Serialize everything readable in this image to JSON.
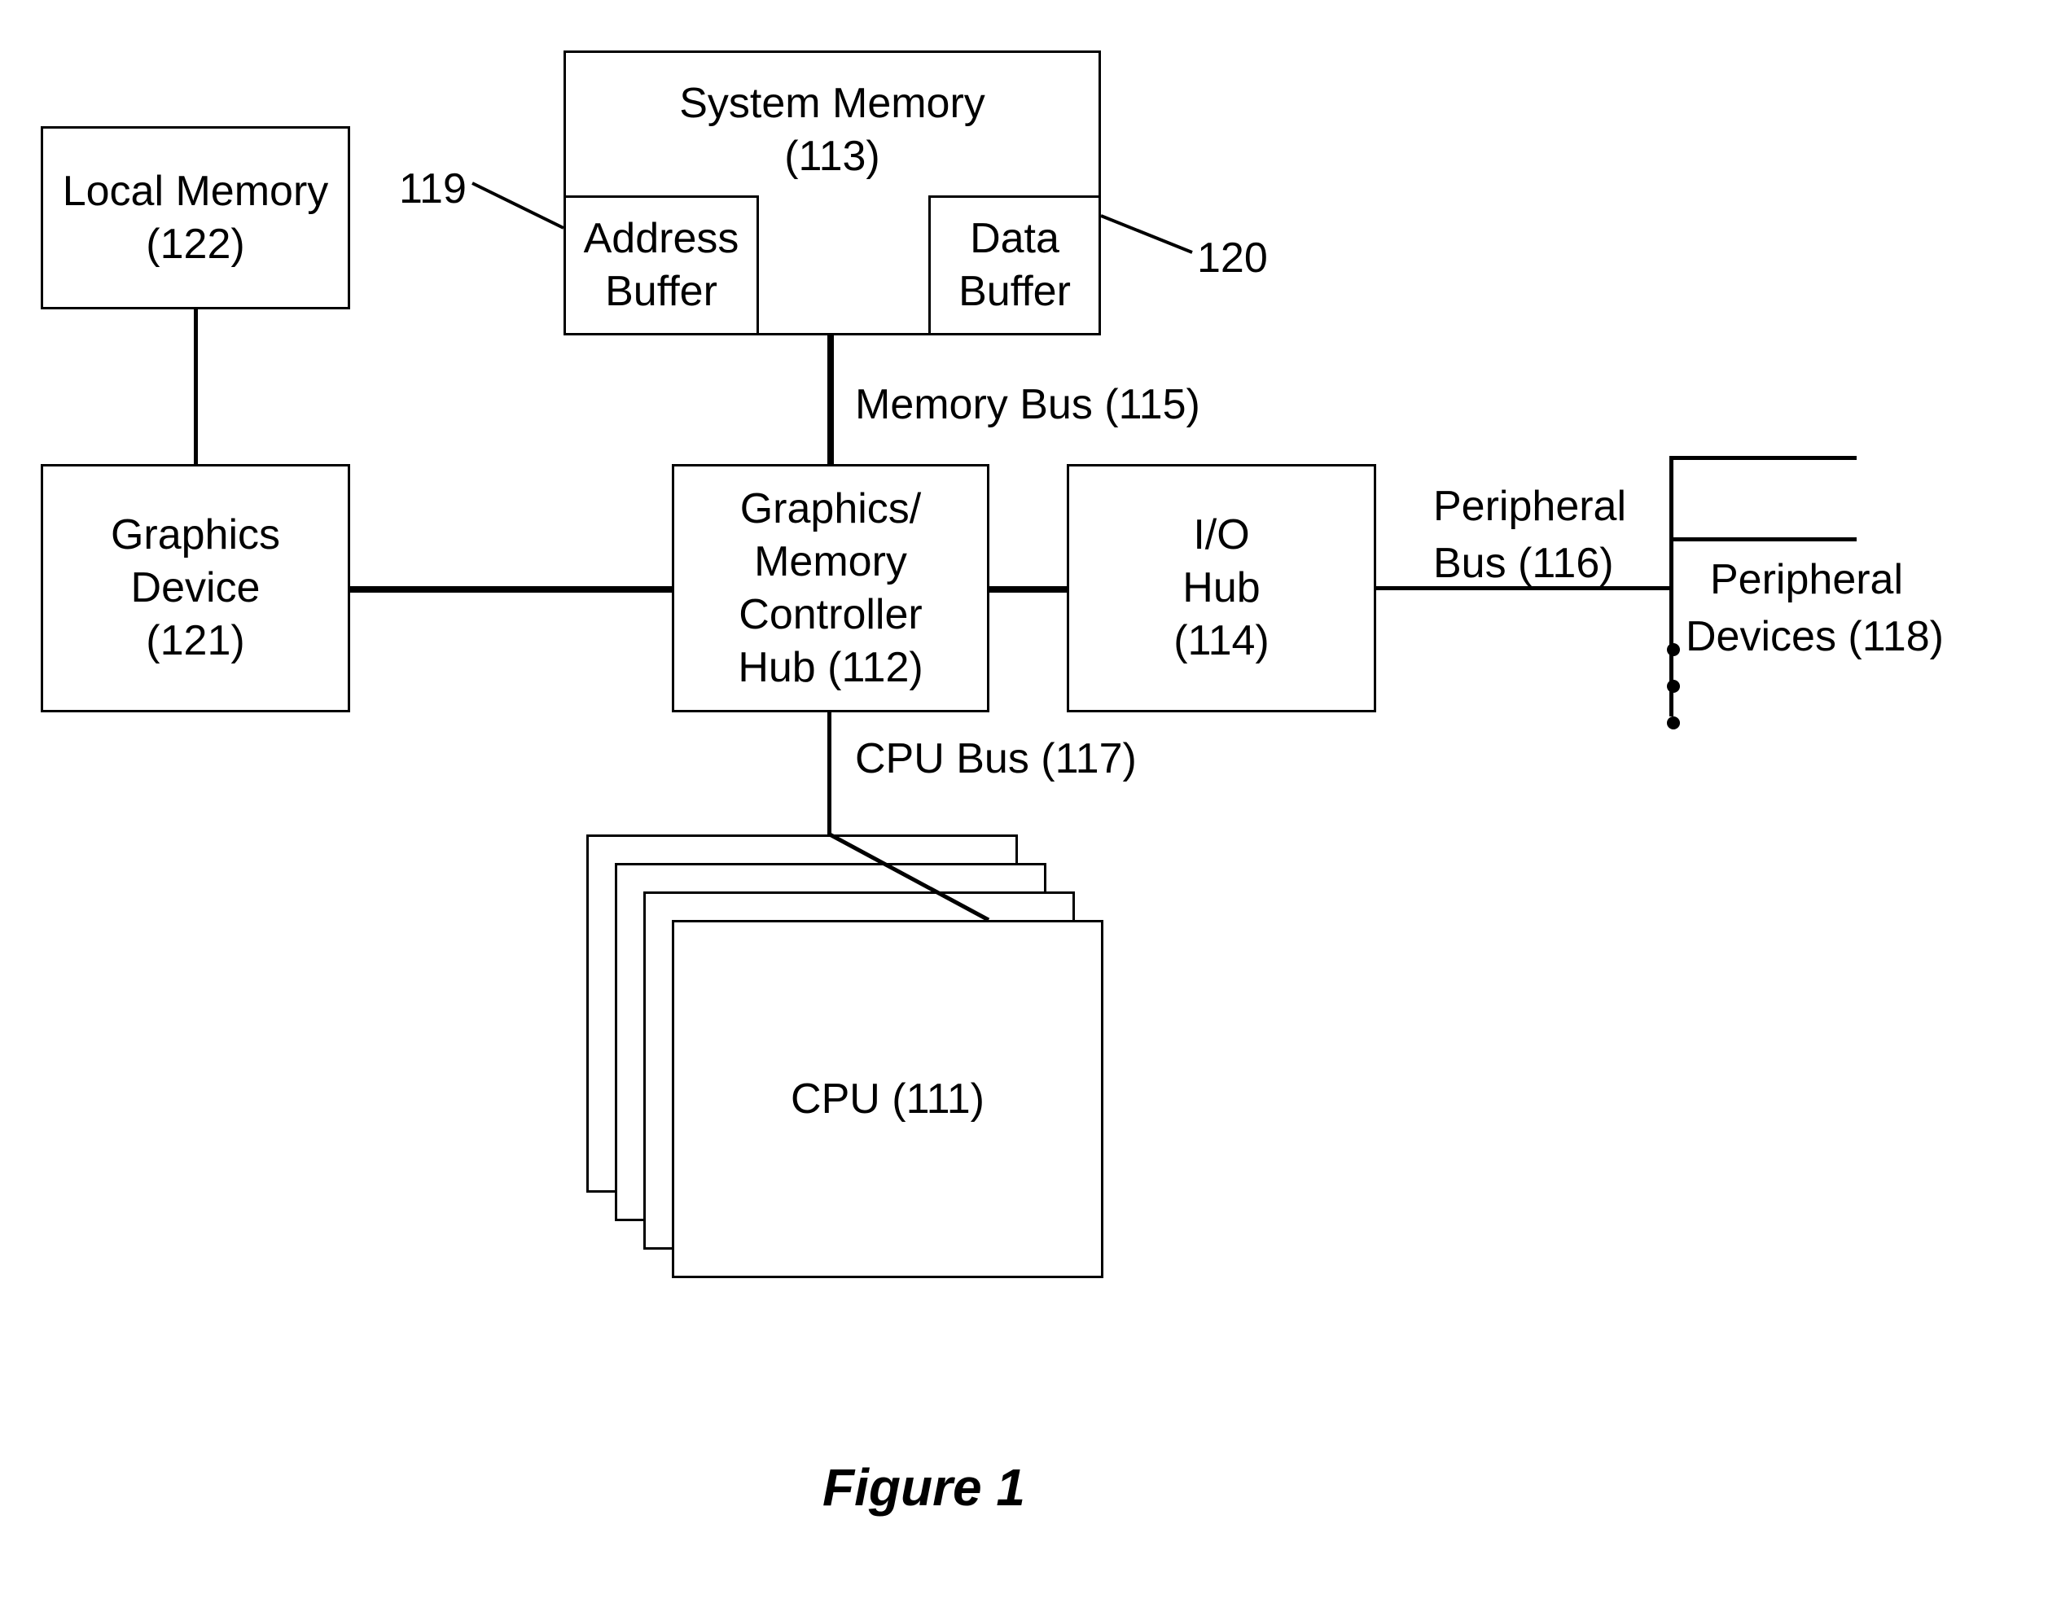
{
  "figure_caption": "Figure 1",
  "blocks": {
    "local_memory": {
      "line1": "Local Memory",
      "line2": "(122)"
    },
    "system_memory": {
      "line1": "System Memory",
      "line2": "(113)"
    },
    "address_buffer": {
      "line1": "Address",
      "line2": "Buffer"
    },
    "data_buffer": {
      "line1": "Data",
      "line2": "Buffer"
    },
    "graphics_device": {
      "line1": "Graphics",
      "line2": "Device",
      "line3": "(121)"
    },
    "gmch": {
      "line1": "Graphics/",
      "line2": "Memory",
      "line3": "Controller",
      "line4": "Hub (112)"
    },
    "io_hub": {
      "line1": "I/O",
      "line2": "Hub",
      "line3": "(114)"
    },
    "cpu": {
      "line1": "CPU (111)"
    }
  },
  "labels": {
    "ref_119": "119",
    "ref_120": "120",
    "memory_bus": "Memory Bus (115)",
    "cpu_bus": "CPU Bus (117)",
    "peripheral_bus_l1": "Peripheral",
    "peripheral_bus_l2": "Bus (116)",
    "peripheral_devices_l1": "Peripheral",
    "peripheral_devices_l2": "Devices (118)"
  }
}
